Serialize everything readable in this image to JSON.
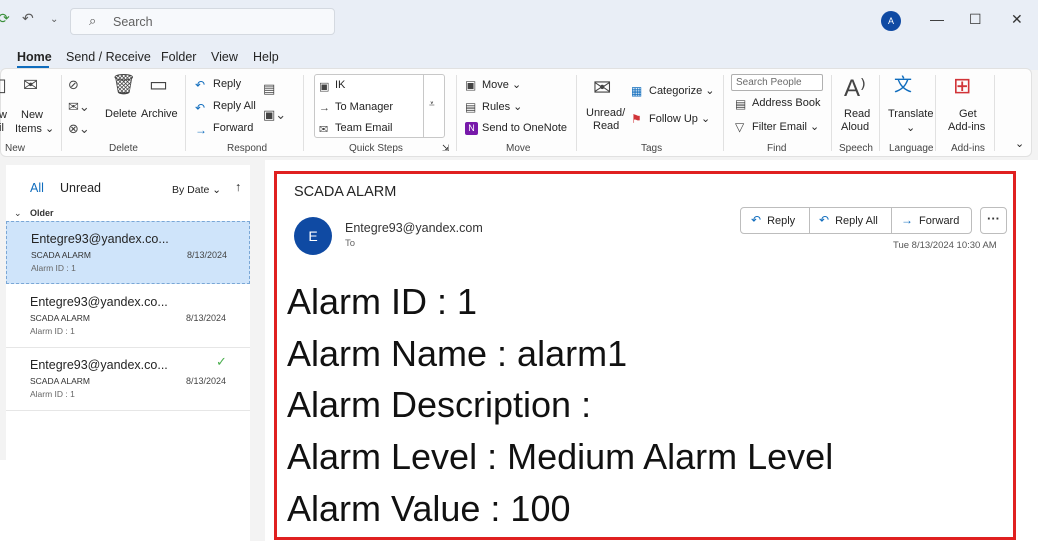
{
  "titlebar": {
    "search_placeholder": "Search",
    "account_initial": "A",
    "sync_icon": "sync-icon",
    "undo_icon": "undo-icon"
  },
  "menu": {
    "tabs": [
      "Home",
      "Send / Receive",
      "Folder",
      "View",
      "Help"
    ]
  },
  "ribbon": {
    "new_group": {
      "label": "New",
      "new_email_partial": "Email",
      "new_items_line1": "New",
      "new_items_line2": "Items ⌄",
      "new_email_fragment": "w",
      "new_email_fragment2": "il"
    },
    "delete_group": {
      "label": "Delete",
      "delete": "Delete",
      "archive": "Archive"
    },
    "respond_group": {
      "label": "Respond",
      "reply": "Reply",
      "reply_all": "Reply All",
      "forward": "Forward"
    },
    "quick_steps": {
      "label": "Quick Steps",
      "items": [
        "IK",
        "To Manager",
        "Team Email"
      ]
    },
    "move_group": {
      "label": "Move",
      "move": "Move ⌄",
      "rules": "Rules ⌄",
      "onenote": "Send to OneNote"
    },
    "tags_group": {
      "label": "Tags",
      "unread_line1": "Unread/",
      "unread_line2": "Read",
      "categorize": "Categorize ⌄",
      "follow_up": "Follow Up ⌄"
    },
    "find_group": {
      "label": "Find",
      "search_people": "Search People",
      "address_book": "Address Book",
      "filter_email": "Filter Email ⌄"
    },
    "speech_group": {
      "label": "Speech",
      "read_line1": "Read",
      "read_line2": "Aloud"
    },
    "language_group": {
      "label": "Language",
      "translate": "Translate",
      "translate_arrow": "⌄"
    },
    "addins_group": {
      "label": "Add-ins",
      "get_line1": "Get",
      "get_line2": "Add-ins"
    }
  },
  "message_list": {
    "filter_all": "All",
    "filter_unread": "Unread",
    "sort": "By Date",
    "section": "Older",
    "items": [
      {
        "from": "Entegre93@yandex.co...",
        "subject": "SCADA ALARM",
        "preview": "Alarm ID : 1",
        "date": "8/13/2024",
        "selected": true
      },
      {
        "from": "Entegre93@yandex.co...",
        "subject": "SCADA ALARM",
        "preview": "Alarm ID : 1",
        "date": "8/13/2024",
        "selected": false
      },
      {
        "from": "Entegre93@yandex.co...",
        "subject": "SCADA ALARM",
        "preview": "Alarm ID : 1",
        "date": "8/13/2024",
        "selected": false,
        "replied": true
      }
    ]
  },
  "reading_pane": {
    "subject": "SCADA ALARM",
    "avatar_initial": "E",
    "sender": "Entegre93@yandex.com",
    "to_label": "To",
    "actions": {
      "reply": "Reply",
      "reply_all": "Reply All",
      "forward": "Forward",
      "more": "···"
    },
    "datetime": "Tue 8/13/2024 10:30 AM",
    "body": [
      "Alarm ID : 1",
      "Alarm Name : alarm1",
      "Alarm Description :",
      "Alarm Level : Medium Alarm Level",
      "Alarm Value : 100"
    ],
    "highlight_color": "#e02020"
  }
}
